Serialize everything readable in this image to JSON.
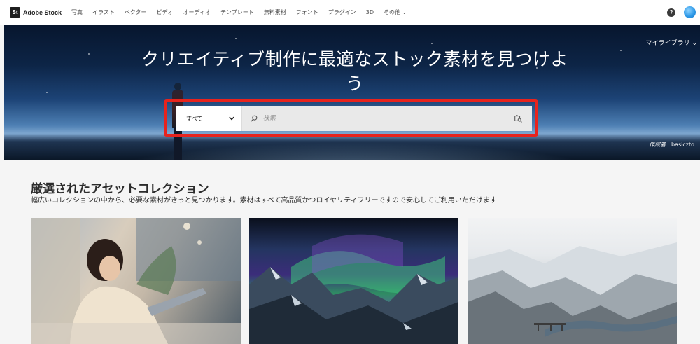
{
  "nav": {
    "logo_mark": "St",
    "brand": "Adobe Stock",
    "links": [
      "写真",
      "イラスト",
      "ベクター",
      "ビデオ",
      "オーディオ",
      "テンプレート",
      "無料素材",
      "フォント",
      "プラグイン",
      "3D",
      "その他 ⌄"
    ],
    "help_glyph": "?"
  },
  "hero": {
    "title": "クリエイティブ制作に最適なストック素材を見つけよう",
    "library_link": "マイライブラリ ⌄",
    "credit_label": "作成者 :",
    "credit_name": " basiczto"
  },
  "search": {
    "scope_value": "すべて",
    "placeholder": "検索",
    "highlight_color": "#e8231d"
  },
  "collections": {
    "title": "厳選されたアセットコレクション",
    "subtitle": "幅広いコレクションの中から、必要な素材がきっと見つかります。素材はすべて高品質かつロイヤリティフリーですので安心してご利用いただけます"
  },
  "icons": {
    "search": "search-icon",
    "visual_search": "camera-search-icon",
    "chevron": "chevron-down-icon",
    "help": "help-icon"
  }
}
